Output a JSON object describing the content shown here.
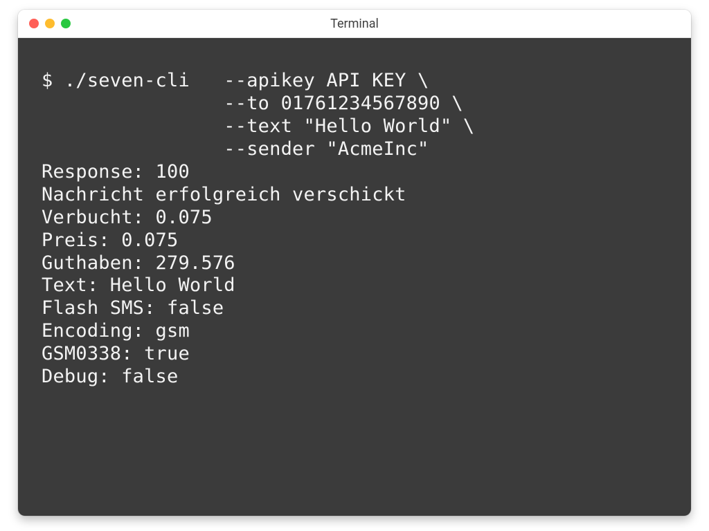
{
  "window": {
    "title": "Terminal"
  },
  "terminal": {
    "lines": [
      "$ ./seven-cli   --apikey API KEY \\",
      "                --to 01761234567890 \\",
      "                --text \"Hello World\" \\",
      "                --sender \"AcmeInc\"",
      "Response: 100",
      "Nachricht erfolgreich verschickt",
      "Verbucht: 0.075",
      "Preis: 0.075",
      "Guthaben: 279.576",
      "Text: Hello World",
      "Flash SMS: false",
      "Encoding: gsm",
      "GSM0338: true",
      "Debug: false"
    ]
  }
}
